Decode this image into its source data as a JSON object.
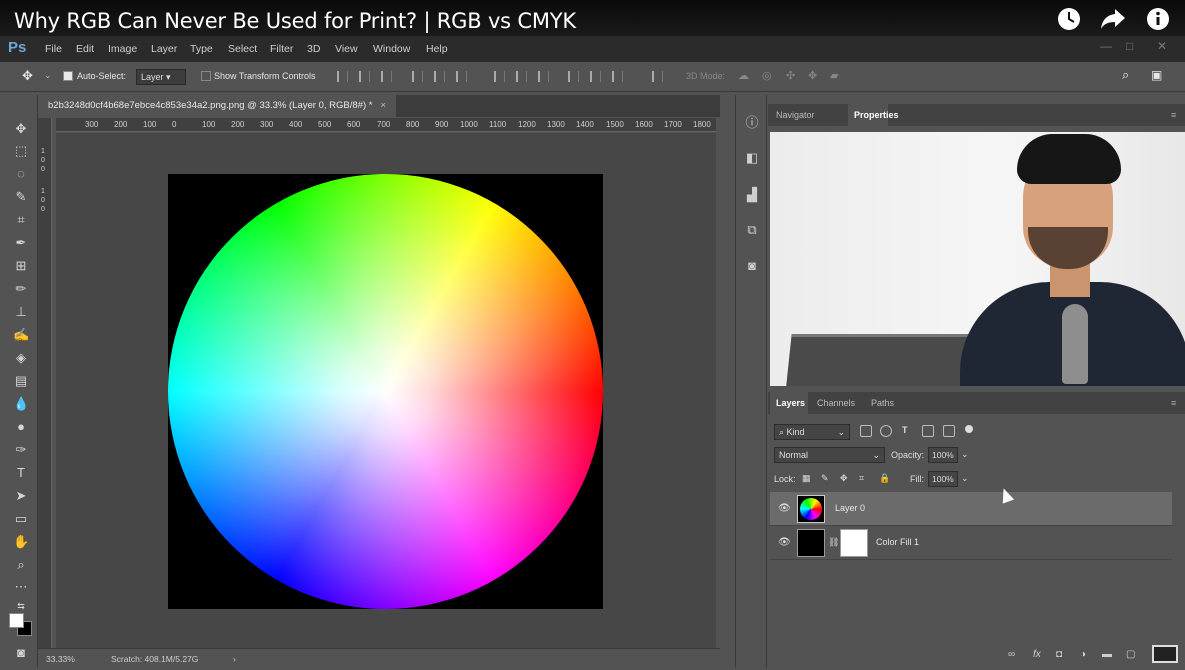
{
  "video": {
    "title": "Why RGB Can Never Be Used for Print? | RGB vs CMYK",
    "icons": [
      "clock-icon",
      "share-icon",
      "info-icon"
    ]
  },
  "app": {
    "logo": "Ps"
  },
  "menu": [
    "File",
    "Edit",
    "Image",
    "Layer",
    "Type",
    "Select",
    "Filter",
    "3D",
    "View",
    "Window",
    "Help"
  ],
  "options": {
    "auto_select_label": "Auto-Select:",
    "auto_select_checked": true,
    "auto_select_value": "Layer",
    "transform_label": "Show Transform Controls",
    "mode3d": "3D Mode:"
  },
  "document": {
    "tab_title": "b2b3248d0cf4b68e7ebce4c853e34a2.png.png @ 33.3% (Layer 0, RGB/8#) *",
    "close": "×"
  },
  "ruler": {
    "h": [
      "300",
      "200",
      "100",
      "0",
      "100",
      "200",
      "300",
      "400",
      "500",
      "600",
      "700",
      "800",
      "900",
      "1000",
      "1100",
      "1200",
      "1300",
      "1400",
      "1500",
      "1600",
      "1700",
      "1800"
    ],
    "v": [
      "1",
      "0",
      "0",
      "1",
      "0",
      "0"
    ]
  },
  "status": {
    "zoom": "33.33%",
    "scratch": "Scratch: 408.1M/5.27G",
    "arrow": "›"
  },
  "panels": {
    "top_tabs": [
      "Navigator",
      "Properties"
    ],
    "active_top": "Properties",
    "layer_tabs": [
      "Layers",
      "Channels",
      "Paths"
    ],
    "active_layer_tab": "Layers"
  },
  "layers_panel": {
    "kind": "Kind",
    "blend": "Normal",
    "opacity_label": "Opacity:",
    "opacity": "100%",
    "lock_label": "Lock:",
    "fill_label": "Fill:",
    "fill": "100%"
  },
  "layers": [
    {
      "name": "Layer 0",
      "selected": true
    },
    {
      "name": "Color Fill 1",
      "selected": false
    }
  ],
  "colors": {
    "ps_blue": "#6ea6d6",
    "panel": "#535353",
    "dark": "#2b2b2b"
  }
}
